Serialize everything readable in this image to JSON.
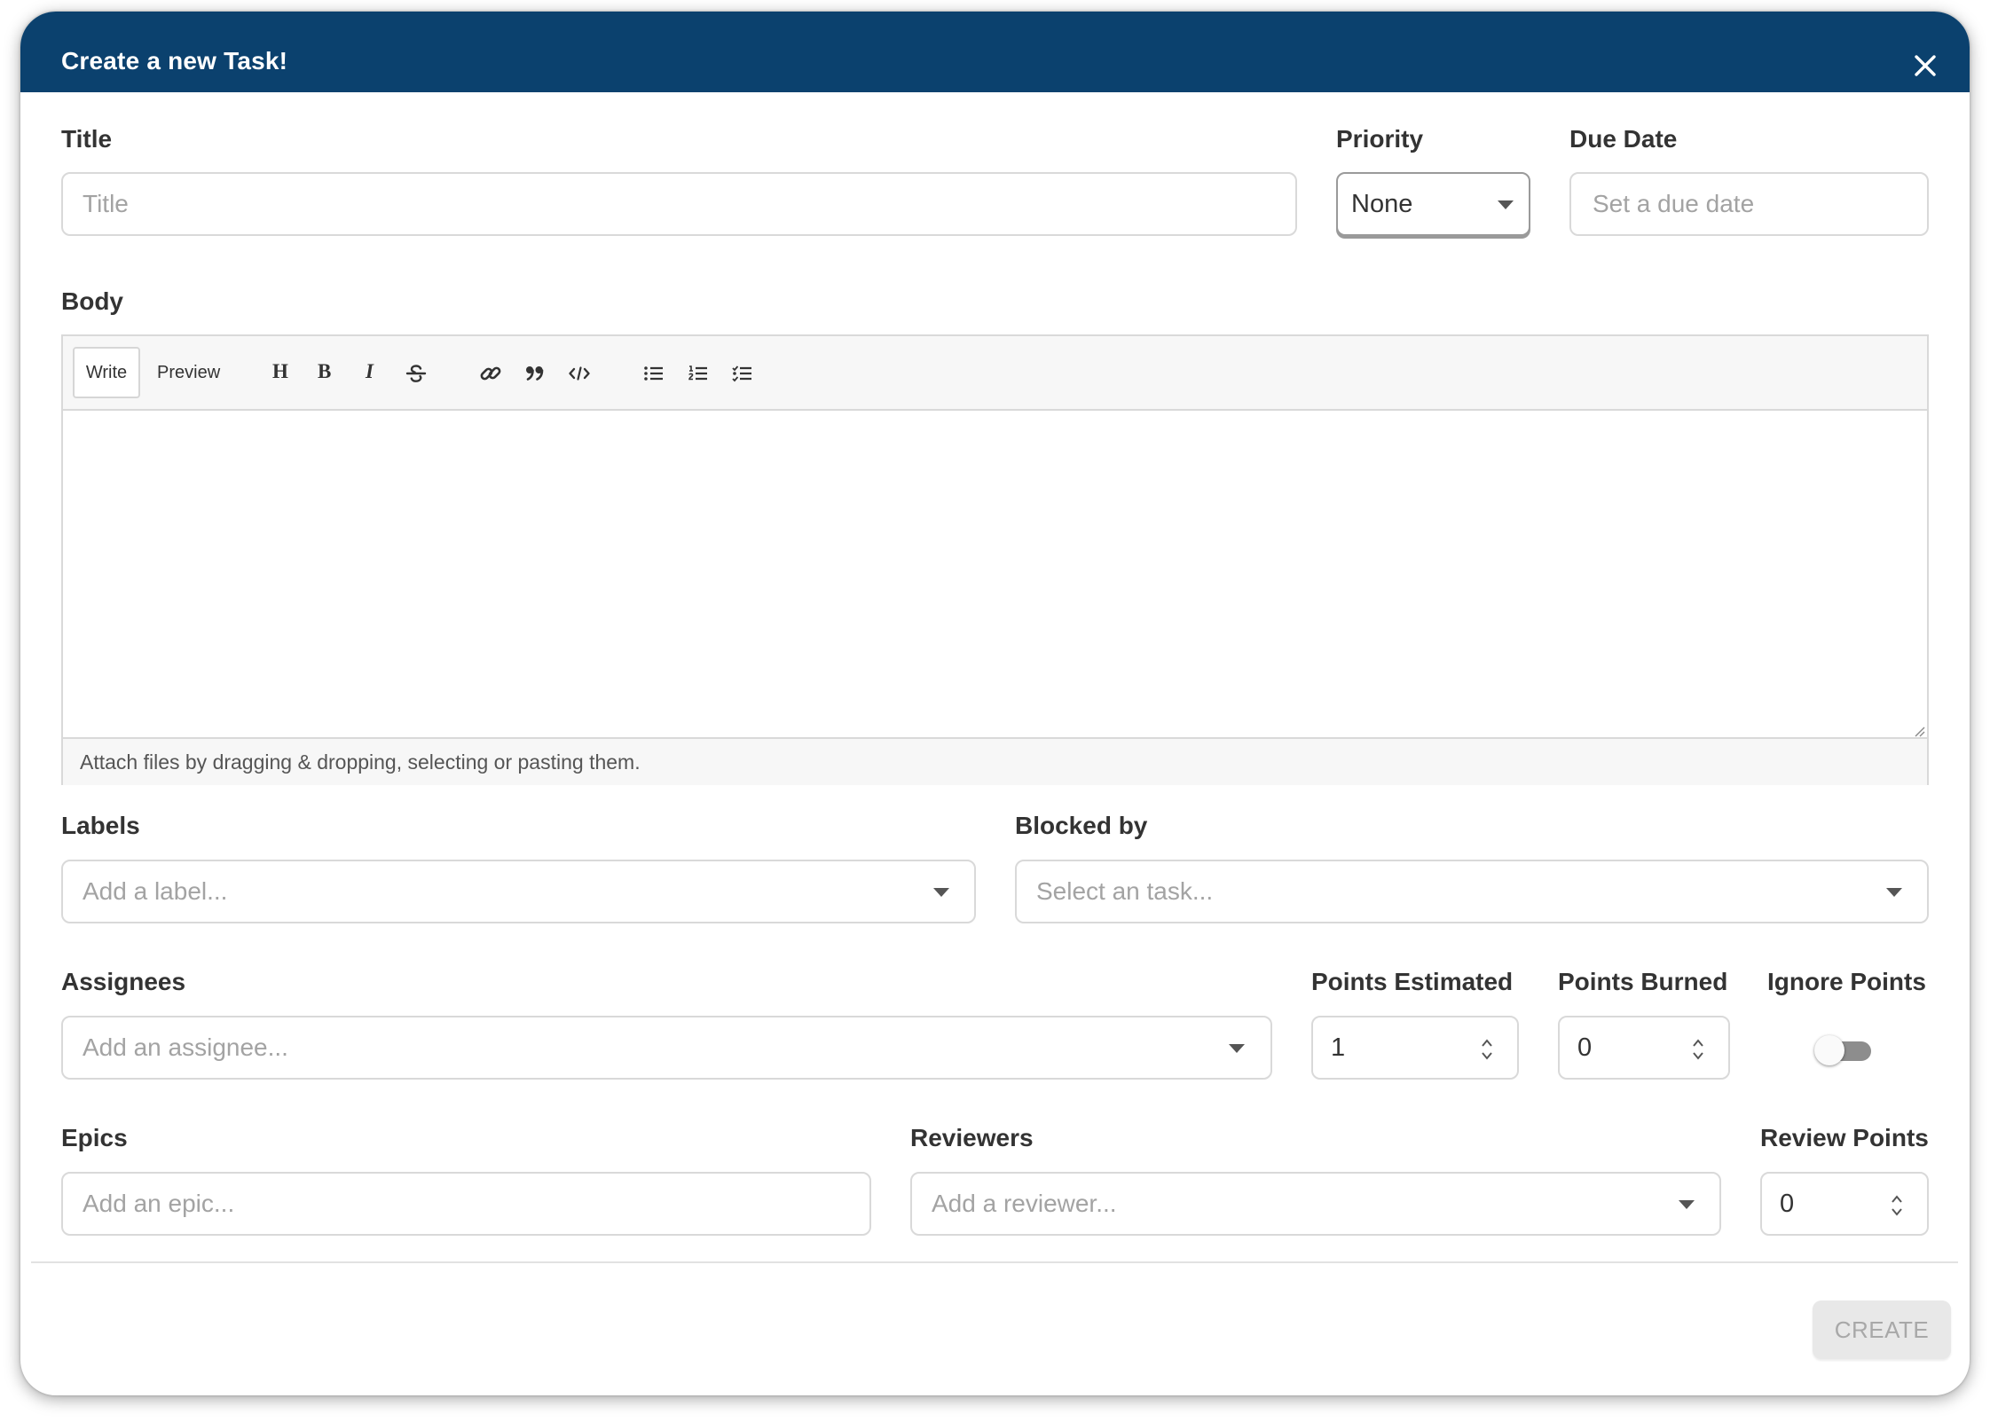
{
  "modal": {
    "title": "Create a new Task!"
  },
  "fields": {
    "title": {
      "label": "Title",
      "placeholder": "Title"
    },
    "priority": {
      "label": "Priority",
      "value": "None"
    },
    "due_date": {
      "label": "Due Date",
      "placeholder": "Set a due date"
    },
    "body": {
      "label": "Body"
    },
    "labels": {
      "label": "Labels",
      "placeholder": "Add a label..."
    },
    "blocked_by": {
      "label": "Blocked by",
      "placeholder": "Select an task..."
    },
    "assignees": {
      "label": "Assignees",
      "placeholder": "Add an assignee..."
    },
    "points_estimated": {
      "label": "Points Estimated",
      "value": "1"
    },
    "points_burned": {
      "label": "Points Burned",
      "value": "0"
    },
    "ignore_points": {
      "label": "Ignore Points",
      "on": false
    },
    "epics": {
      "label": "Epics",
      "placeholder": "Add an epic..."
    },
    "reviewers": {
      "label": "Reviewers",
      "placeholder": "Add a reviewer..."
    },
    "review_points": {
      "label": "Review Points",
      "value": "0"
    }
  },
  "editor": {
    "tabs": {
      "write": "Write",
      "preview": "Preview"
    },
    "toolbar": {
      "heading": "H",
      "bold": "B",
      "italic": "I",
      "icons": [
        "strikethrough-icon",
        "link-icon",
        "quote-icon",
        "code-icon",
        "unordered-list-icon",
        "ordered-list-icon",
        "task-list-icon"
      ]
    },
    "attach_hint": "Attach files by dragging & dropping, selecting or pasting them."
  },
  "actions": {
    "create_label": "CREATE"
  },
  "colors": {
    "header": "#0b416e",
    "border": "#d9d9d9",
    "placeholder": "#a3a3a3",
    "disabled_button": "#e8e8e8"
  }
}
